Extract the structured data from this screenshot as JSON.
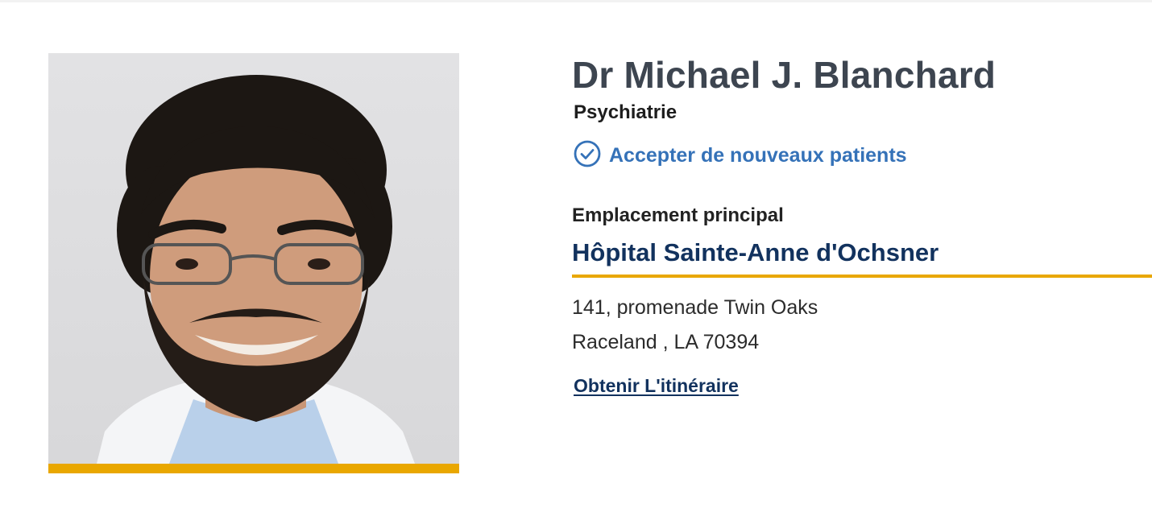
{
  "doctor": {
    "name": "Dr Michael J. Blanchard",
    "specialty": "Psychiatrie",
    "accepting_label": "Accepter de nouveaux patients"
  },
  "location": {
    "heading": "Emplacement principal",
    "name": "Hôpital Sainte-Anne d'Ochsner",
    "address_line1": "141, promenade Twin Oaks",
    "address_line2": "Raceland , LA 70394",
    "directions_label": "Obtenir L'itinéraire"
  },
  "icons": {
    "accepting": "check-circle-icon"
  },
  "colors": {
    "name_text": "#3d4550",
    "accent_blue": "#3572b8",
    "navy": "#12325e",
    "gold": "#e9a700"
  }
}
